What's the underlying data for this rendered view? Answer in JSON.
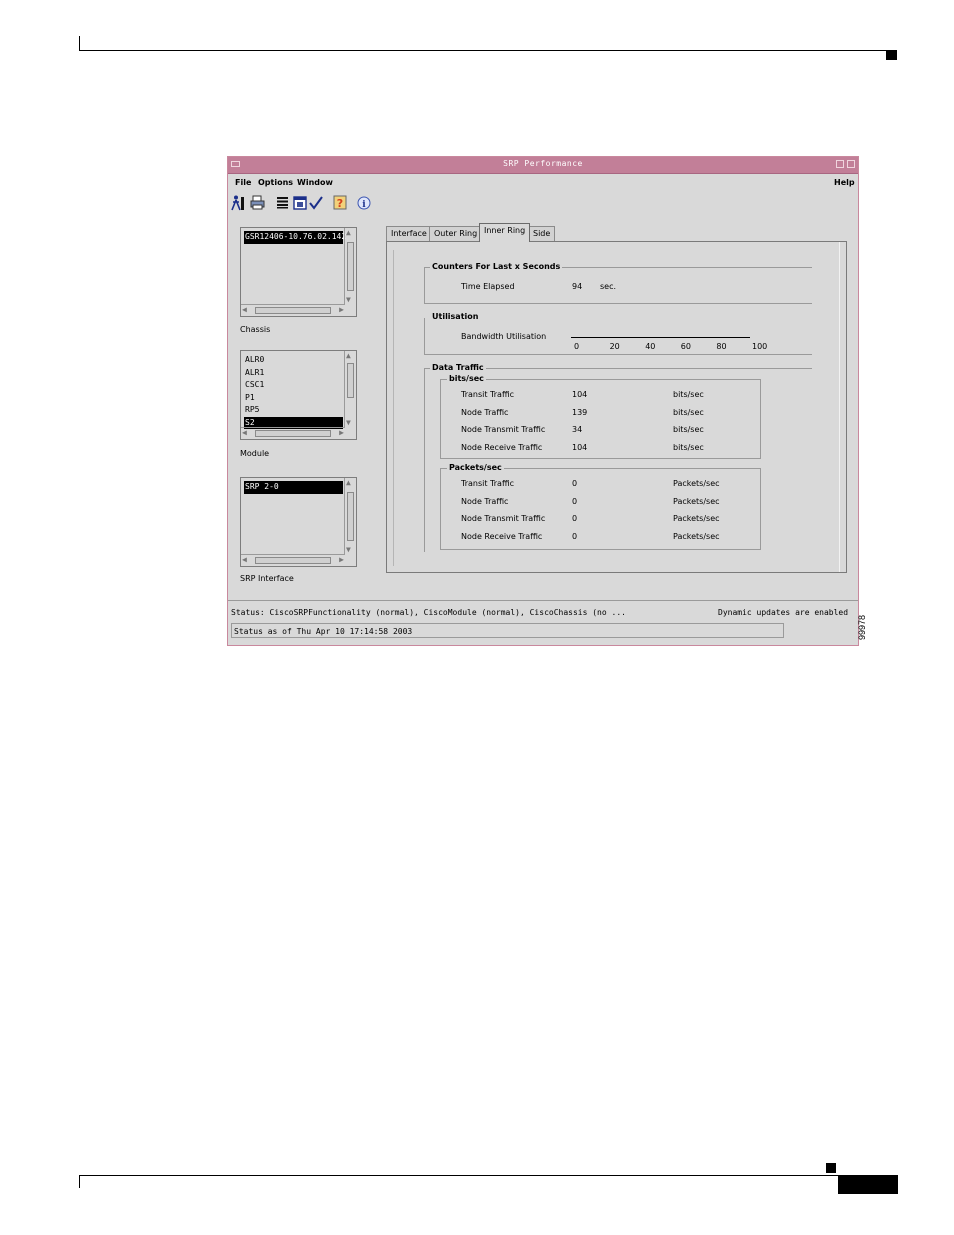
{
  "window": {
    "title": "SRP Performance"
  },
  "menubar": {
    "file": "File",
    "options": "Options",
    "window": "Window",
    "help": "Help"
  },
  "toolbar": {
    "icons": [
      "run-icon",
      "printer-icon",
      "list-icon",
      "window-icon",
      "checkmark-icon",
      "help-icon",
      "info-icon"
    ]
  },
  "left_panel": {
    "chassis": {
      "label": "Chassis",
      "items": [
        "GSR12406-10.76.02.142"
      ],
      "selected": 0
    },
    "module": {
      "label": "Module",
      "items": [
        "ALR0",
        "ALR1",
        "CSC1",
        "P1",
        "RP5",
        "S2"
      ],
      "selected": 5
    },
    "srp_interface": {
      "label": "SRP Interface",
      "items": [
        "SRP 2-0"
      ],
      "selected": 0
    }
  },
  "tabs": [
    {
      "label": "Interface"
    },
    {
      "label": "Outer Ring"
    },
    {
      "label": "Inner Ring",
      "active": true
    },
    {
      "label": "Side"
    }
  ],
  "counters": {
    "title": "Counters For Last x Seconds",
    "time_elapsed_label": "Time Elapsed",
    "time_elapsed_value": "94",
    "time_elapsed_unit": "sec."
  },
  "utilisation": {
    "title": "Utilisation",
    "bandwidth_label": "Bandwidth Utilisation",
    "scale": [
      "0",
      "20",
      "40",
      "60",
      "80",
      "100"
    ]
  },
  "data_traffic": {
    "title": "Data Traffic",
    "bits": {
      "title": "bits/sec",
      "rows": [
        {
          "label": "Transit Traffic",
          "value": "104",
          "unit": "bits/sec"
        },
        {
          "label": "Node Traffic",
          "value": "139",
          "unit": "bits/sec"
        },
        {
          "label": "Node Transmit Traffic",
          "value": "34",
          "unit": "bits/sec"
        },
        {
          "label": "Node Receive Traffic",
          "value": "104",
          "unit": "bits/sec"
        }
      ]
    },
    "packets": {
      "title": "Packets/sec",
      "rows": [
        {
          "label": "Transit Traffic",
          "value": "0",
          "unit": "Packets/sec"
        },
        {
          "label": "Node Traffic",
          "value": "0",
          "unit": "Packets/sec"
        },
        {
          "label": "Node Transmit Traffic",
          "value": "0",
          "unit": "Packets/sec"
        },
        {
          "label": "Node Receive Traffic",
          "value": "0",
          "unit": "Packets/sec"
        }
      ]
    }
  },
  "status": {
    "line": "Status: CiscoSRPFunctionality (normal), CiscoModule (normal), CiscoChassis (no ...",
    "updates": "Dynamic updates are enabled",
    "as_of": "Status as of Thu Apr 10 17:14:58 2003"
  },
  "figure_id": "99978",
  "colors": {
    "titlebar": "#c27f98",
    "window_bg": "#d9d9d9"
  }
}
